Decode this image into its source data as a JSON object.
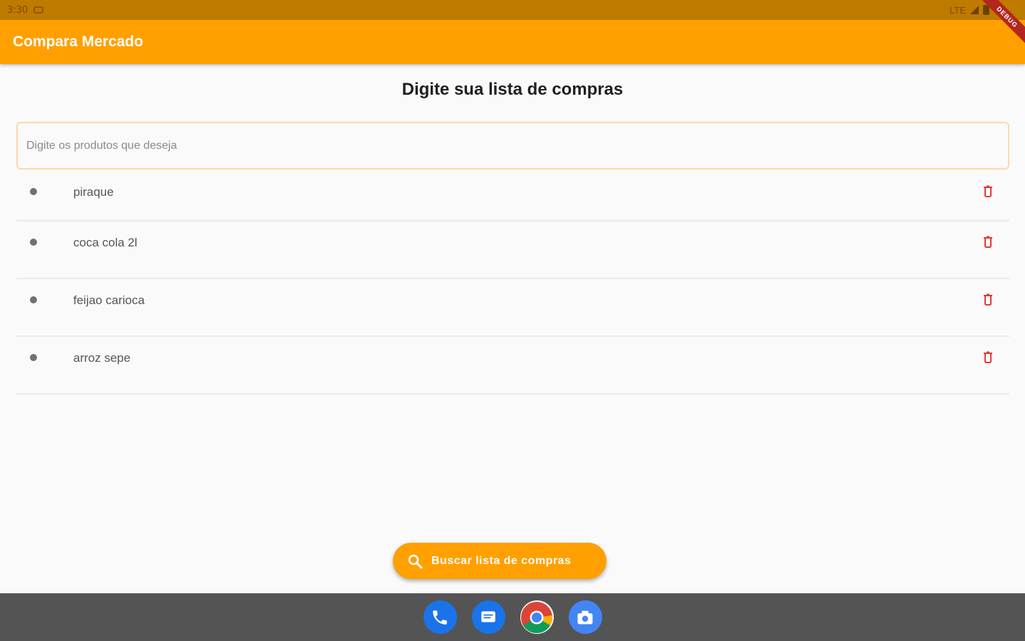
{
  "status_bar": {
    "time": "3:30",
    "network": "LTE"
  },
  "debug_banner": "DEBUG",
  "app_bar": {
    "title": "Compara Mercado"
  },
  "page": {
    "heading": "Digite sua lista de compras"
  },
  "input": {
    "placeholder": "Digite os produtos que deseja",
    "value": ""
  },
  "list": {
    "items": [
      {
        "label": "piraque"
      },
      {
        "label": "coca cola 2l"
      },
      {
        "label": "feijao carioca"
      },
      {
        "label": "arroz sepe"
      }
    ]
  },
  "fab": {
    "label": "Buscar lista de compras",
    "icon": "search-icon"
  },
  "dock": {
    "apps": [
      "phone-icon",
      "messages-icon",
      "chrome-icon",
      "camera-icon"
    ]
  },
  "colors": {
    "primary": "#ffa000",
    "status_bar": "#bf7a00",
    "delete": "#e53935",
    "dock": "#545454"
  }
}
